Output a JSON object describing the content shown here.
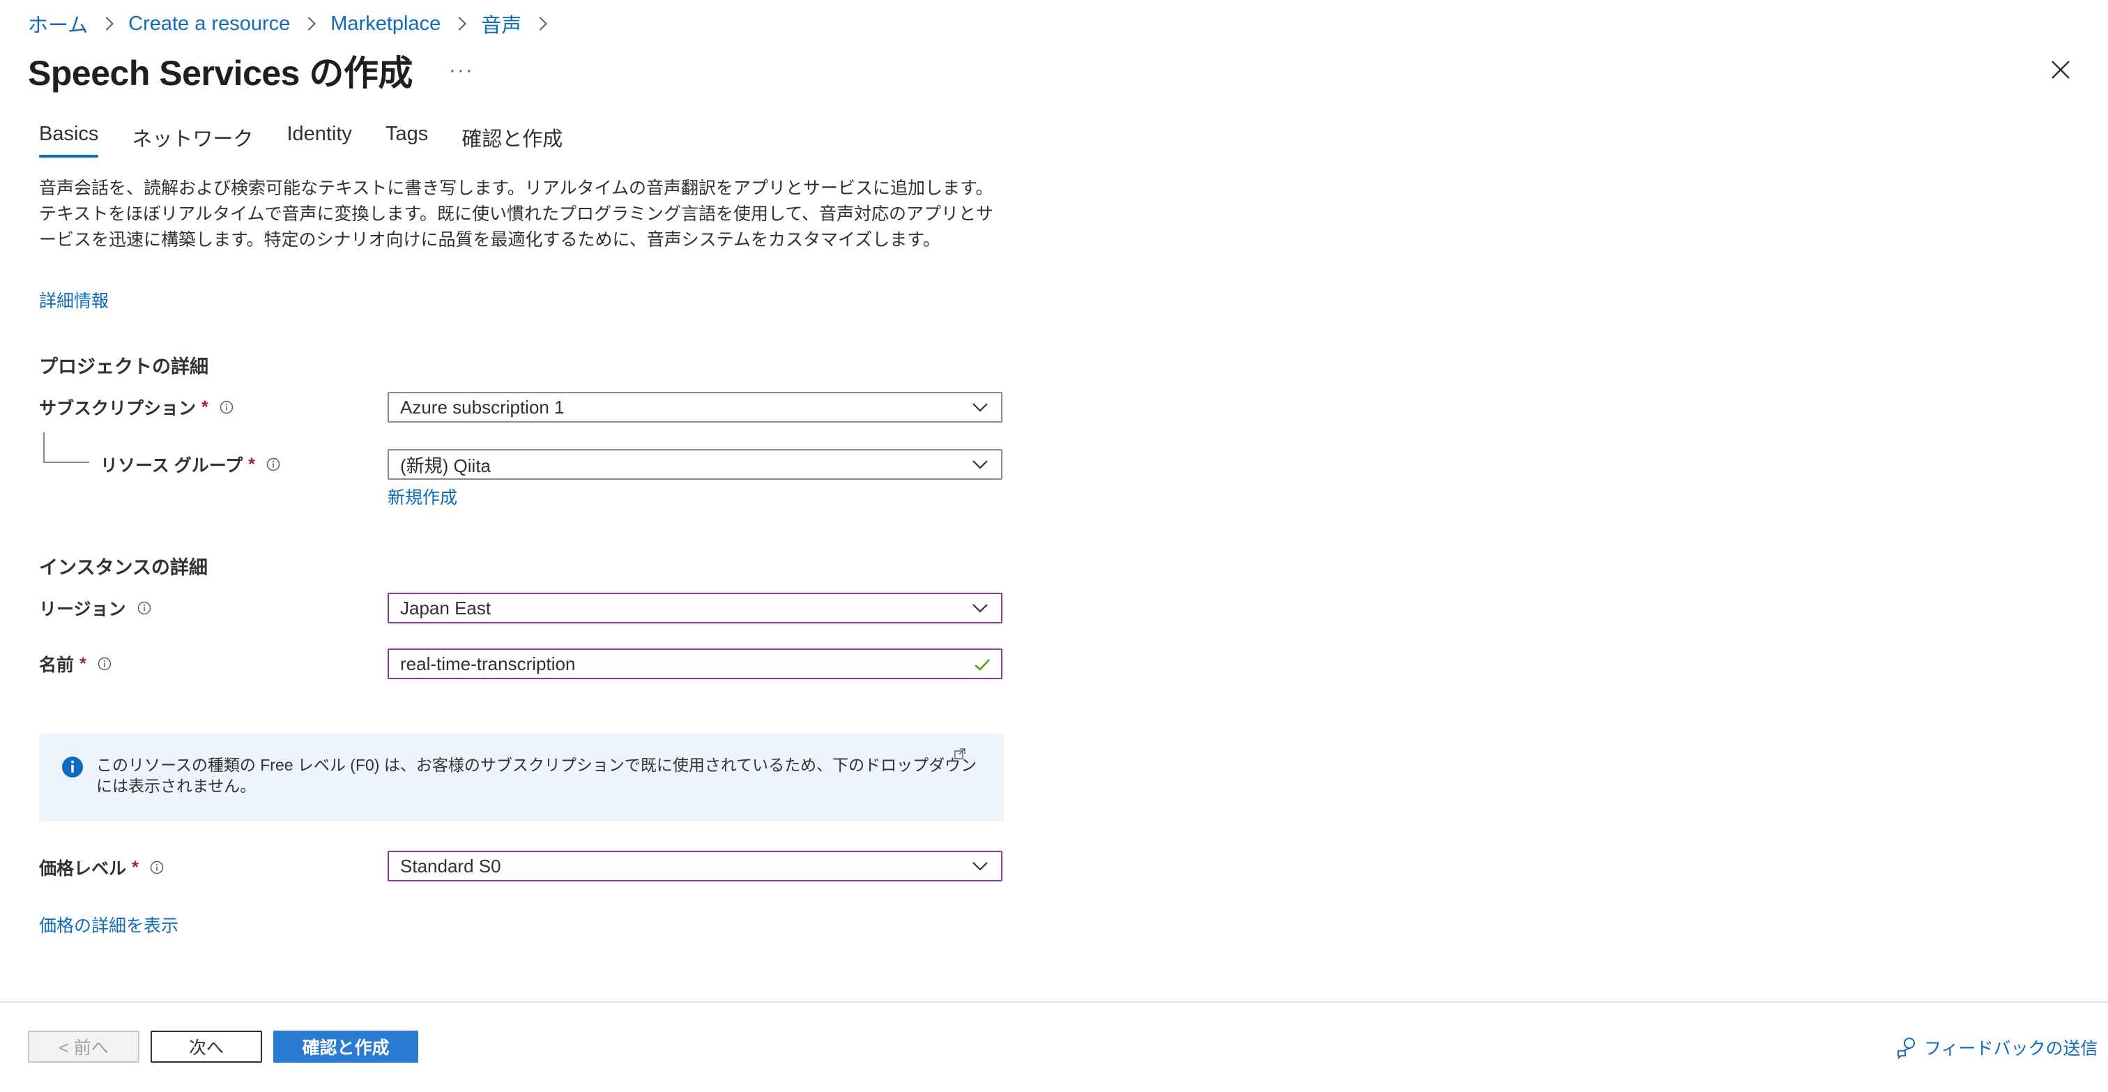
{
  "breadcrumb": {
    "items": [
      "ホーム",
      "Create a resource",
      "Marketplace",
      "音声"
    ]
  },
  "header": {
    "title": "Speech Services の作成",
    "more": "···"
  },
  "tabs": [
    {
      "label": "Basics",
      "active": true
    },
    {
      "label": "ネットワーク",
      "active": false
    },
    {
      "label": "Identity",
      "active": false
    },
    {
      "label": "Tags",
      "active": false
    },
    {
      "label": "確認と作成",
      "active": false
    }
  ],
  "description": "音声会話を、読解および検索可能なテキストに書き写します。リアルタイムの音声翻訳をアプリとサービスに追加します。テキストをほぼリアルタイムで音声に変換します。既に使い慣れたプログラミング言語を使用して、音声対応のアプリとサービスを迅速に構築します。特定のシナリオ向けに品質を最適化するために、音声システムをカスタマイズします。",
  "learn_more": "詳細情報",
  "project": {
    "heading": "プロジェクトの詳細",
    "subscription_label": "サブスクリプション",
    "subscription_value": "Azure subscription 1",
    "resource_group_label": "リソース グループ",
    "resource_group_value": "(新規) Qiita",
    "create_new": "新規作成"
  },
  "instance": {
    "heading": "インスタンスの詳細",
    "region_label": "リージョン",
    "region_value": "Japan East",
    "name_label": "名前",
    "name_value": "real-time-transcription"
  },
  "notice": {
    "text": "このリソースの種類の Free レベル (F0) は、お客様のサブスクリプションで既に使用されているため、下のドロップダウンには表示されません。"
  },
  "pricing": {
    "label": "価格レベル",
    "value": "Standard S0",
    "details_link": "価格の詳細を表示"
  },
  "footer": {
    "prev": "< 前へ",
    "next": "次へ",
    "create": "確認と作成",
    "feedback": "フィードバックの送信"
  },
  "required_mark": "*",
  "colors": {
    "link": "#0f6cbd",
    "focus_border": "#8a38a4",
    "required": "#a4262c",
    "primary_button": "#2a7bd3",
    "notice_bg": "#eef4fd",
    "valid_check": "#57a300"
  }
}
